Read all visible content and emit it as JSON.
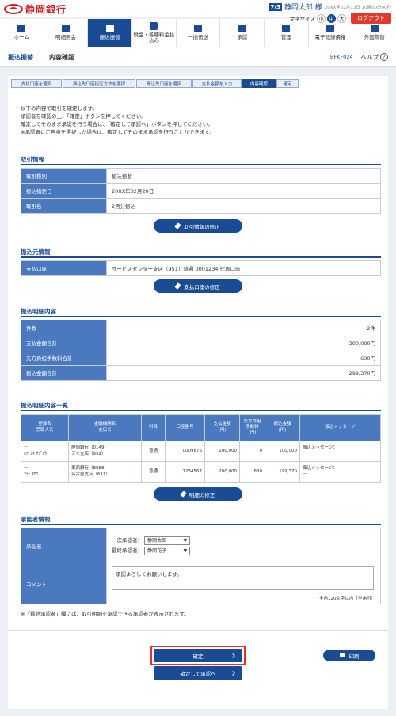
{
  "header": {
    "bank": "静岡銀行",
    "user_icon": "7/5",
    "user": "静岡太郎 様",
    "timestamp": "20XX年02月13日 10時00分00秒",
    "text_size_label": "文字サイズ",
    "sizes": [
      "小",
      "中",
      "大"
    ],
    "logout": "ログアウト"
  },
  "nav": [
    "ホーム",
    "明細照会",
    "振込振替",
    "税金・各種料金払込み",
    "一括伝送",
    "承認",
    "管理",
    "電子記録債権",
    "外国為替"
  ],
  "titlebar": {
    "section": "振込振替",
    "page": "内容確認",
    "screen_id": "BFKF024",
    "help": "ヘルプ"
  },
  "steps": [
    "支払口座を選択",
    "振込先口座指定方法を選択",
    "振込先口座を選択",
    "支払金額を入力",
    "内容確認",
    "確定"
  ],
  "intro": [
    "以下の内容で取引を確定します。",
    "承認者を確認の上、「確定」ボタンを押してください。",
    "確定してそのまま承認を行う場合は、「確定して承認へ」ボタンを押してください。",
    "※承認者にご自身を選択した場合は、確定してそのまま承認を行うことができます。"
  ],
  "trade": {
    "title": "取引情報",
    "rows": [
      {
        "label": "取引種別",
        "value": "振込振替"
      },
      {
        "label": "振込指定日",
        "value": "20XX年02月20日"
      },
      {
        "label": "取引名",
        "value": "2月分振込"
      }
    ],
    "edit": "取引情報の修正"
  },
  "source": {
    "title": "振込元情報",
    "label": "支払口座",
    "value": "サービスセンター支店（951）普通 0001234 代表口座",
    "edit": "支払口座の修正"
  },
  "detail": {
    "title": "振込明細内容",
    "rows": [
      {
        "label": "件数",
        "value": "2件"
      },
      {
        "label": "支払金額合計",
        "value": "300,000円"
      },
      {
        "label": "先方負担手数料合計",
        "value": "630円"
      },
      {
        "label": "振込金額合計",
        "value": "299,370円"
      }
    ]
  },
  "list": {
    "title": "振込明細内容一覧",
    "headers": [
      "登録名\n受取人名",
      "金融機関名\n支店名",
      "科目",
      "口座番号",
      "支払金額\n(円)",
      "先方負担\n手数料\n(円)",
      "振込金額\n(円)",
      "振込メッセージ"
    ],
    "rows": [
      {
        "reg": "－",
        "name": "ｶﾌﾞｼｷ ｻﾌﾞﾛｳ",
        "bank": "静岡銀行（0149）",
        "branch": "デモ支店（952）",
        "type": "普通",
        "acct": "0009876",
        "pay": "100,000",
        "fee": "0",
        "amt": "100,000",
        "msg": "振込メッセージ：",
        "msg2": "－"
      },
      {
        "reg": "－",
        "name": "ｱｲﾃ ﾀﾛｳ",
        "bank": "東西銀行（8888）",
        "branch": "名古屋支店（611）",
        "type": "普通",
        "acct": "1234567",
        "pay": "200,000",
        "fee": "630",
        "amt": "199,370",
        "msg": "振込メッセージ：",
        "msg2": "－"
      }
    ],
    "edit": "明細の修正"
  },
  "approver": {
    "title": "承認者情報",
    "label": "承認者",
    "first_label": "一次承認者：",
    "first": "静岡太郎",
    "final_label": "最終承認者：",
    "final": "静岡花子",
    "comment_label": "コメント",
    "comment": "承認よろしくお願いします。",
    "limit": "全角120文字以内［半角可］",
    "note": "※「最終承認者」欄には、取引明細を承認できる承認者が表示されます。"
  },
  "buttons": {
    "confirm": "確定",
    "confirm_approve": "確定して承認へ",
    "print": "印刷"
  }
}
